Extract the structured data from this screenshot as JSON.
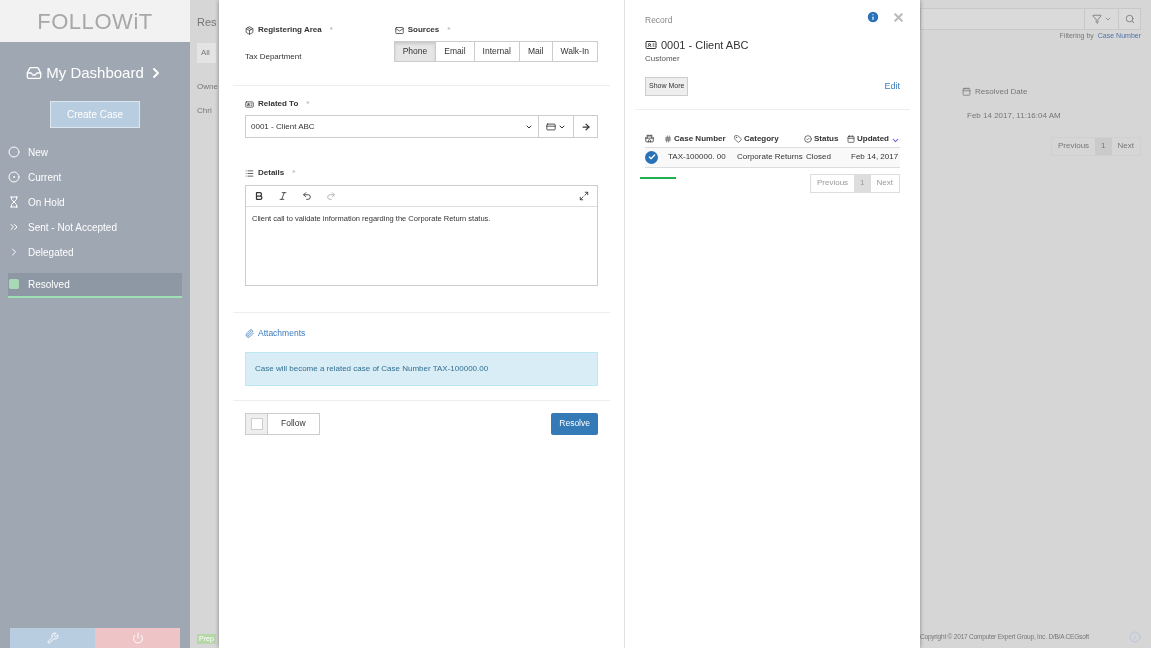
{
  "sidebar": {
    "logo": "FOLLOWiT",
    "dashboard": "My Dashboard",
    "create_button": "Create Case",
    "items": [
      {
        "label": "New",
        "kind": "circle",
        "selected": false
      },
      {
        "label": "Current",
        "kind": "dot-circle",
        "selected": false
      },
      {
        "label": "On Hold",
        "kind": "hourglass",
        "selected": false
      },
      {
        "label": "Sent - Not Accepted",
        "kind": "double-chevron",
        "selected": false
      },
      {
        "label": "Delegated",
        "kind": "chevron",
        "selected": false
      },
      {
        "label": "Resolved",
        "kind": "square",
        "selected": true
      }
    ]
  },
  "background": {
    "heading": "Res",
    "filter_tab": "All",
    "column_owner": "Owne",
    "cell_owner": "Chri",
    "badge": "Prep",
    "filter_note": "Filtering by",
    "filter_field": "Case Number",
    "column_resolved": "Resolved Date",
    "cell_resolved": "Feb 14 2017, 11:16:04 AM",
    "pagination": {
      "previous": "Previous",
      "page": "1",
      "next": "Next"
    },
    "footer": "Copyright © 2017 Computer Expert Group, Inc. D/B/A CEGsoft"
  },
  "modal": {
    "registering_area": {
      "label": "Registering Area",
      "required": "*",
      "value": "Tax Department"
    },
    "sources": {
      "label": "Sources",
      "required": "*",
      "options": [
        {
          "label": "Phone",
          "selected": true
        },
        {
          "label": "Email",
          "selected": false
        },
        {
          "label": "Internal",
          "selected": false
        },
        {
          "label": "Mail",
          "selected": false
        },
        {
          "label": "Walk-In",
          "selected": false
        }
      ]
    },
    "related_to": {
      "label": "Related To",
      "required": "*",
      "value": "0001 - Client ABC"
    },
    "details": {
      "label": "Details",
      "required": "*",
      "value": "Client call to validate information regarding the Corporate Return status."
    },
    "attachments": "Attachments",
    "info_message": "Case will become a related case of Case Number TAX-100000.00",
    "follow": {
      "label": "Follow",
      "checked": false
    },
    "resolve_button": "Resolve",
    "record": {
      "heading": "Record",
      "title": "0001 - Client ABC",
      "subtitle": "Customer",
      "show_more": "Show More",
      "edit": "Edit",
      "table": {
        "columns": [
          "Case Number",
          "Category",
          "Status",
          "Updated"
        ],
        "rows": [
          {
            "case_number": "TAX-100000. 00",
            "category": "Corporate Returns",
            "status": "Closed",
            "updated": "Feb 14, 2017",
            "checked": true
          }
        ]
      },
      "pagination": {
        "previous": "Previous",
        "page": "1",
        "next": "Next"
      }
    }
  }
}
